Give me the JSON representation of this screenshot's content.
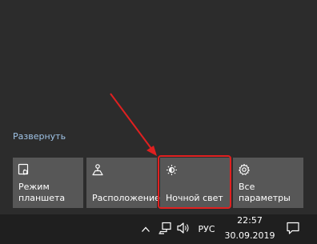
{
  "action_center": {
    "expand_label": "Развернуть",
    "tiles": [
      {
        "label": "Режим\nпланшета",
        "icon": "tablet-mode-icon"
      },
      {
        "label": "Расположение",
        "icon": "location-icon"
      },
      {
        "label": "Ночной свет",
        "icon": "night-light-icon"
      },
      {
        "label": "Все\nпараметры",
        "icon": "settings-gear-icon"
      }
    ]
  },
  "taskbar": {
    "language": "РУС",
    "time": "22:57",
    "date": "30.09.2019",
    "tray_icons": [
      "chevron-up-icon",
      "network-icon",
      "volume-icon"
    ],
    "notification_icon": "notification-icon"
  },
  "colors": {
    "panel_bg": "#2c2c2c",
    "tile_bg": "#575757",
    "link": "#9fc3e6",
    "taskbar_bg": "#1f1f1f",
    "annotation_red": "#e02020"
  }
}
